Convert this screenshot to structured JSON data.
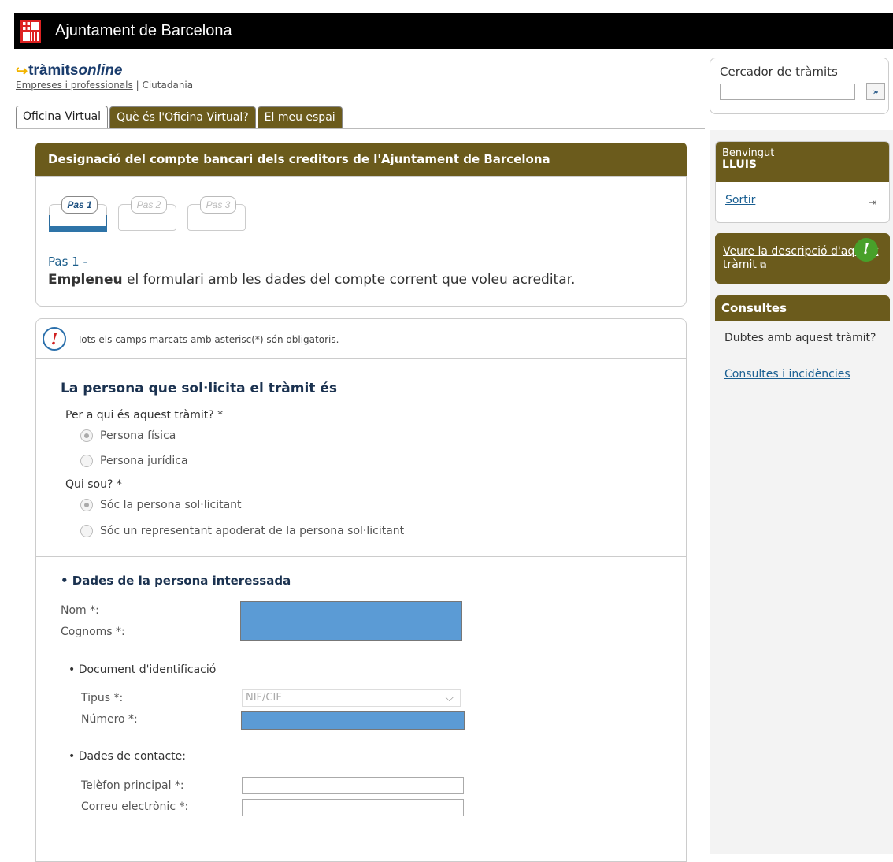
{
  "header": {
    "title": "Ajuntament de Barcelona"
  },
  "brand": {
    "logo_main": "tràmits",
    "logo_accent": "online",
    "link_business": "Empreses i professionals",
    "separator": "|",
    "link_citizens": "Ciutadania"
  },
  "search": {
    "label": "Cercador de tràmits",
    "value": "",
    "button": "»"
  },
  "tabs": [
    {
      "label": "Oficina Virtual"
    },
    {
      "label": "Què és l'Oficina Virtual?"
    },
    {
      "label": "El meu espai"
    }
  ],
  "main": {
    "title": "Designació del compte bancari dels creditors de l'Ajuntament de Barcelona",
    "steps": [
      "Pas 1",
      "Pas 2",
      "Pas 3"
    ],
    "step_title": "Pas 1 -",
    "step_desc_bold": "Empleneu",
    "step_desc_rest": " el formulari amb les dades del compte corrent que voleu acreditar."
  },
  "form": {
    "notice": "Tots els camps marcats amb asterisc(*) són obligatoris.",
    "section_title": "La persona que sol·licita el tràmit és",
    "q1_label": "Per a qui és aquest tràmit? *",
    "q1_options": [
      "Persona física",
      "Persona jurídica"
    ],
    "q2_label": "Qui sou? *",
    "q2_options": [
      "Sóc la persona sol·licitant",
      "Sóc un representant apoderat de la persona sol·licitant"
    ],
    "person_title": "• Dades de la persona interessada",
    "nom_label": "Nom *:",
    "cognoms_label": "Cognoms *:",
    "doc_title": "• Document d'identificació",
    "tipus_label": "Tipus *:",
    "tipus_value": "NIF/CIF",
    "numero_label": "Número *:",
    "contact_title": "• Dades de contacte:",
    "phone_label": "Telèfon principal *:",
    "email_label": "Correu electrònic *:"
  },
  "sidebar": {
    "welcome": "Benvingut",
    "user": "LLUIS",
    "logout": "Sortir",
    "logout_icon": "⇥",
    "desc_link": "Veure la descripció d'aquest tràmit",
    "desc_icon": "!",
    "consult_title": "Consultes",
    "consult_question": "Dubtes amb aquest tràmit?",
    "consult_link": "Consultes i incidències"
  },
  "colors": {
    "topbar": "#000000",
    "olive": "#6b5b1c",
    "link_blue": "#1a5f92",
    "redaction": "#5b9bd5",
    "step_bar": "#2e74a8"
  }
}
